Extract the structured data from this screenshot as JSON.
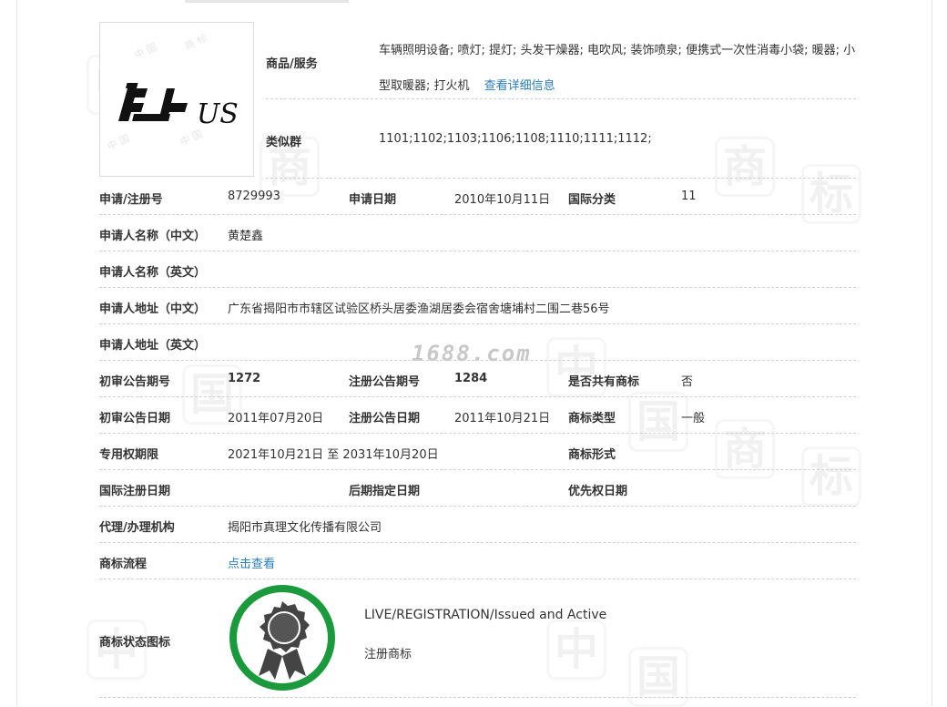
{
  "goods_label": "商品/服务",
  "goods_text": "车辆照明设备; 喷灯; 提灯; 头发干燥器; 电吹风; 装饰喷泉; 便携式一次性消毒小袋; 暖器; 小型取暖器; 打火机",
  "goods_link": "查看详细信息",
  "similar_group_label": "类似群",
  "similar_group_value": "1101;1102;1103;1106;1108;1110;1111;1112;",
  "reg_no_label": "申请/注册号",
  "reg_no_value": "8729993",
  "apply_date_label": "申请日期",
  "apply_date_value": "2010年10月11日",
  "intl_class_label": "国际分类",
  "intl_class_value": "11",
  "applicant_cn_label": "申请人名称（中文）",
  "applicant_cn_value": "黄楚鑫",
  "applicant_en_label": "申请人名称（英文）",
  "address_cn_label": "申请人地址（中文）",
  "address_cn_value": "广东省揭阳市市辖区试验区桥头居委渔湖居委会宿舍塘埔村二围二巷56号",
  "address_en_label": "申请人地址（英文）",
  "prelim_no_label": "初审公告期号",
  "prelim_no_value": "1272",
  "reg_pub_no_label": "注册公告期号",
  "reg_pub_no_value": "1284",
  "shared_label": "是否共有商标",
  "shared_value": "否",
  "prelim_date_label": "初审公告日期",
  "prelim_date_value": "2011年07月20日",
  "reg_pub_date_label": "注册公告日期",
  "reg_pub_date_value": "2011年10月21日",
  "tm_type_label": "商标类型",
  "tm_type_value": "一般",
  "exclusive_label": "专用权期限",
  "exclusive_value": "2021年10月21日 至 2031年10月20日",
  "tm_form_label": "商标形式",
  "intl_reg_date_label": "国际注册日期",
  "later_date_label": "后期指定日期",
  "priority_date_label": "优先权日期",
  "agent_label": "代理/办理机构",
  "agent_value": "揭阳市真理文化传播有限公司",
  "process_label": "商标流程",
  "process_link": "点击查看",
  "status_icon_label": "商标状态图标",
  "status_en": "LIVE/REGISTRATION/Issued and Active",
  "status_cn": "注册商标",
  "site_watermark": "1688.com",
  "logo_text": "US",
  "colors": {
    "link": "#2a7dbd",
    "badge_ring": "#1a9a3c",
    "badge_dark": "#444444"
  },
  "icons": {
    "status_badge": "award-ribbon-icon"
  }
}
